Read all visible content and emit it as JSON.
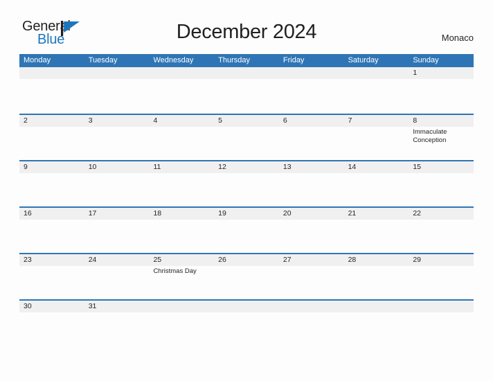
{
  "brand": {
    "name_part1": "General",
    "name_part2": "Blue",
    "flag_color": "#1c75bc",
    "text_color": "#231f20"
  },
  "header": {
    "title": "December 2024",
    "region": "Monaco"
  },
  "theme": {
    "header_blue": "#2f75b5",
    "band_gray": "#f0f0f0",
    "page_background": "#fdfdfd",
    "text": "#231f20"
  },
  "calendar": {
    "weekday_names": [
      "Monday",
      "Tuesday",
      "Wednesday",
      "Thursday",
      "Friday",
      "Saturday",
      "Sunday"
    ],
    "weeks": [
      {
        "short": false,
        "days": [
          {
            "num": "",
            "event": ""
          },
          {
            "num": "",
            "event": ""
          },
          {
            "num": "",
            "event": ""
          },
          {
            "num": "",
            "event": ""
          },
          {
            "num": "",
            "event": ""
          },
          {
            "num": "",
            "event": ""
          },
          {
            "num": "1",
            "event": ""
          }
        ]
      },
      {
        "short": false,
        "days": [
          {
            "num": "2",
            "event": ""
          },
          {
            "num": "3",
            "event": ""
          },
          {
            "num": "4",
            "event": ""
          },
          {
            "num": "5",
            "event": ""
          },
          {
            "num": "6",
            "event": ""
          },
          {
            "num": "7",
            "event": ""
          },
          {
            "num": "8",
            "event": "Immaculate Conception"
          }
        ]
      },
      {
        "short": false,
        "days": [
          {
            "num": "9",
            "event": ""
          },
          {
            "num": "10",
            "event": ""
          },
          {
            "num": "11",
            "event": ""
          },
          {
            "num": "12",
            "event": ""
          },
          {
            "num": "13",
            "event": ""
          },
          {
            "num": "14",
            "event": ""
          },
          {
            "num": "15",
            "event": ""
          }
        ]
      },
      {
        "short": false,
        "days": [
          {
            "num": "16",
            "event": ""
          },
          {
            "num": "17",
            "event": ""
          },
          {
            "num": "18",
            "event": ""
          },
          {
            "num": "19",
            "event": ""
          },
          {
            "num": "20",
            "event": ""
          },
          {
            "num": "21",
            "event": ""
          },
          {
            "num": "22",
            "event": ""
          }
        ]
      },
      {
        "short": false,
        "days": [
          {
            "num": "23",
            "event": ""
          },
          {
            "num": "24",
            "event": ""
          },
          {
            "num": "25",
            "event": "Christmas Day"
          },
          {
            "num": "26",
            "event": ""
          },
          {
            "num": "27",
            "event": ""
          },
          {
            "num": "28",
            "event": ""
          },
          {
            "num": "29",
            "event": ""
          }
        ]
      },
      {
        "short": true,
        "days": [
          {
            "num": "30",
            "event": ""
          },
          {
            "num": "31",
            "event": ""
          },
          {
            "num": "",
            "event": ""
          },
          {
            "num": "",
            "event": ""
          },
          {
            "num": "",
            "event": ""
          },
          {
            "num": "",
            "event": ""
          },
          {
            "num": "",
            "event": ""
          }
        ]
      }
    ]
  }
}
